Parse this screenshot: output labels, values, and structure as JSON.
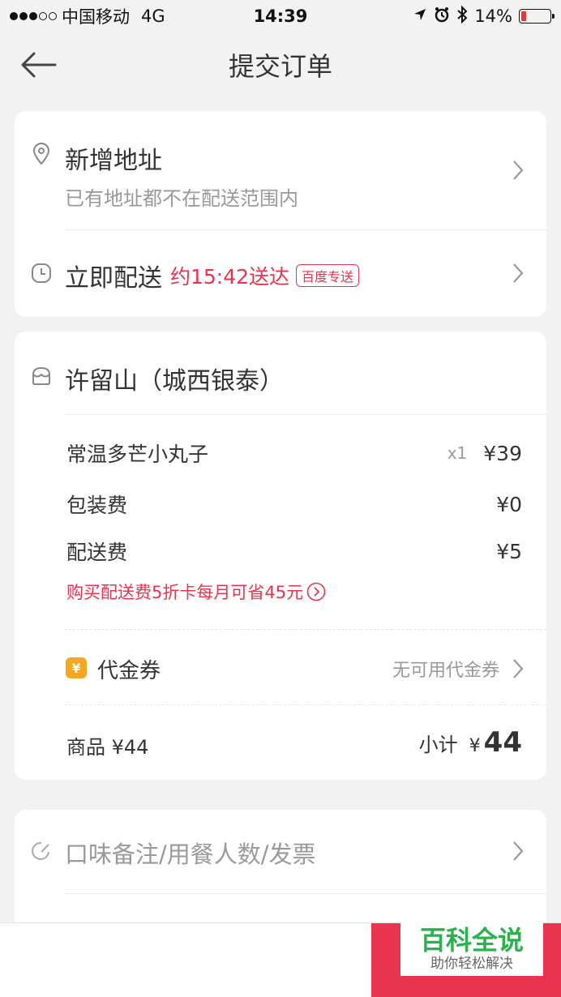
{
  "status_bar": {
    "carrier": "中国移动",
    "network": "4G",
    "time": "14:39",
    "battery": "14%"
  },
  "nav": {
    "title": "提交订单"
  },
  "address": {
    "title": "新增地址",
    "subtitle": "已有地址都不在配送范围内"
  },
  "delivery": {
    "label": "立即配送",
    "eta": "约15:42送达",
    "badge": "百度专送"
  },
  "shop": {
    "name": "许留山（城西银泰）"
  },
  "items": [
    {
      "name": "常温多芒小丸子",
      "qty": "x1",
      "price": "¥39"
    }
  ],
  "fees": {
    "packing_label": "包装费",
    "packing_value": "¥0",
    "delivery_label": "配送费",
    "delivery_value": "¥5",
    "promo": "购买配送费5折卡每月可省45元"
  },
  "coupon": {
    "icon_text": "¥",
    "label": "代金券",
    "value": "无可用代金券"
  },
  "summary": {
    "goods_label": "商品 ¥44",
    "subtotal_label": "小计",
    "currency": "¥",
    "subtotal_value": "44"
  },
  "notes": {
    "label": "口味备注/用餐人数/发票"
  },
  "watermark": {
    "title": "百科全说",
    "subtitle": "助你轻松解决"
  },
  "colors": {
    "accent": "#e8344e",
    "coupon": "#f5a623",
    "watermark": "#2bb24c"
  }
}
